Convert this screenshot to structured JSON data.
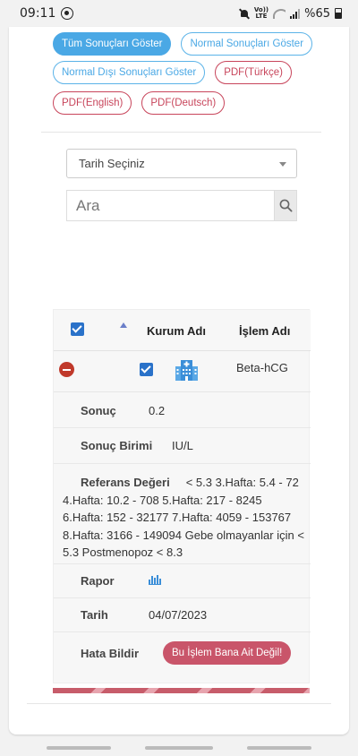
{
  "status_bar": {
    "time": "09:11",
    "volte_top": "Vo))",
    "volte_bottom": "LTE",
    "battery": "%65"
  },
  "filters": {
    "all_results": "Tüm Sonuçları Göster",
    "normal_results": "Normal Sonuçları Göster",
    "abnormal_results": "Normal Dışı Sonuçları Göster",
    "pdf_turkish": "PDF(Türkçe)",
    "pdf_english": "PDF(English)",
    "pdf_german": "PDF(Deutsch)"
  },
  "date_select": {
    "value": "Tarih Seçiniz"
  },
  "search": {
    "placeholder": "Ara"
  },
  "table": {
    "columns": {
      "institution": "Kurum Adı",
      "procedure": "İşlem Adı"
    },
    "row": {
      "procedure": "Beta-hCG",
      "selected": true
    }
  },
  "details": {
    "result_label": "Sonuç",
    "result_value": "0.2",
    "unit_label": "Sonuç Birimi",
    "unit_value": "IU/L",
    "reference_label": "Referans Değeri",
    "reference_value": "< 5.3 3.Hafta: 5.4 - 72 4.Hafta: 10.2 - 708 5.Hafta: 217 - 8245 6.Hafta: 152 - 32177 7.Hafta: 4059 - 153767 8.Hafta: 3166 - 149094 Gebe olmayanlar için < 5.3 Postmenopoz < 8.3",
    "report_label": "Rapor",
    "date_label": "Tarih",
    "date_value": "04/07/2023",
    "report_error_label": "Hata Bildir",
    "report_error_button": "Bu İşlem Bana Ait Değil!"
  },
  "colors": {
    "primary": "#4aa8e5",
    "pdf": "#c8455b",
    "checkbox": "#2a72c9",
    "error_button": "#c9556a",
    "remove_icon": "#c0392b"
  }
}
